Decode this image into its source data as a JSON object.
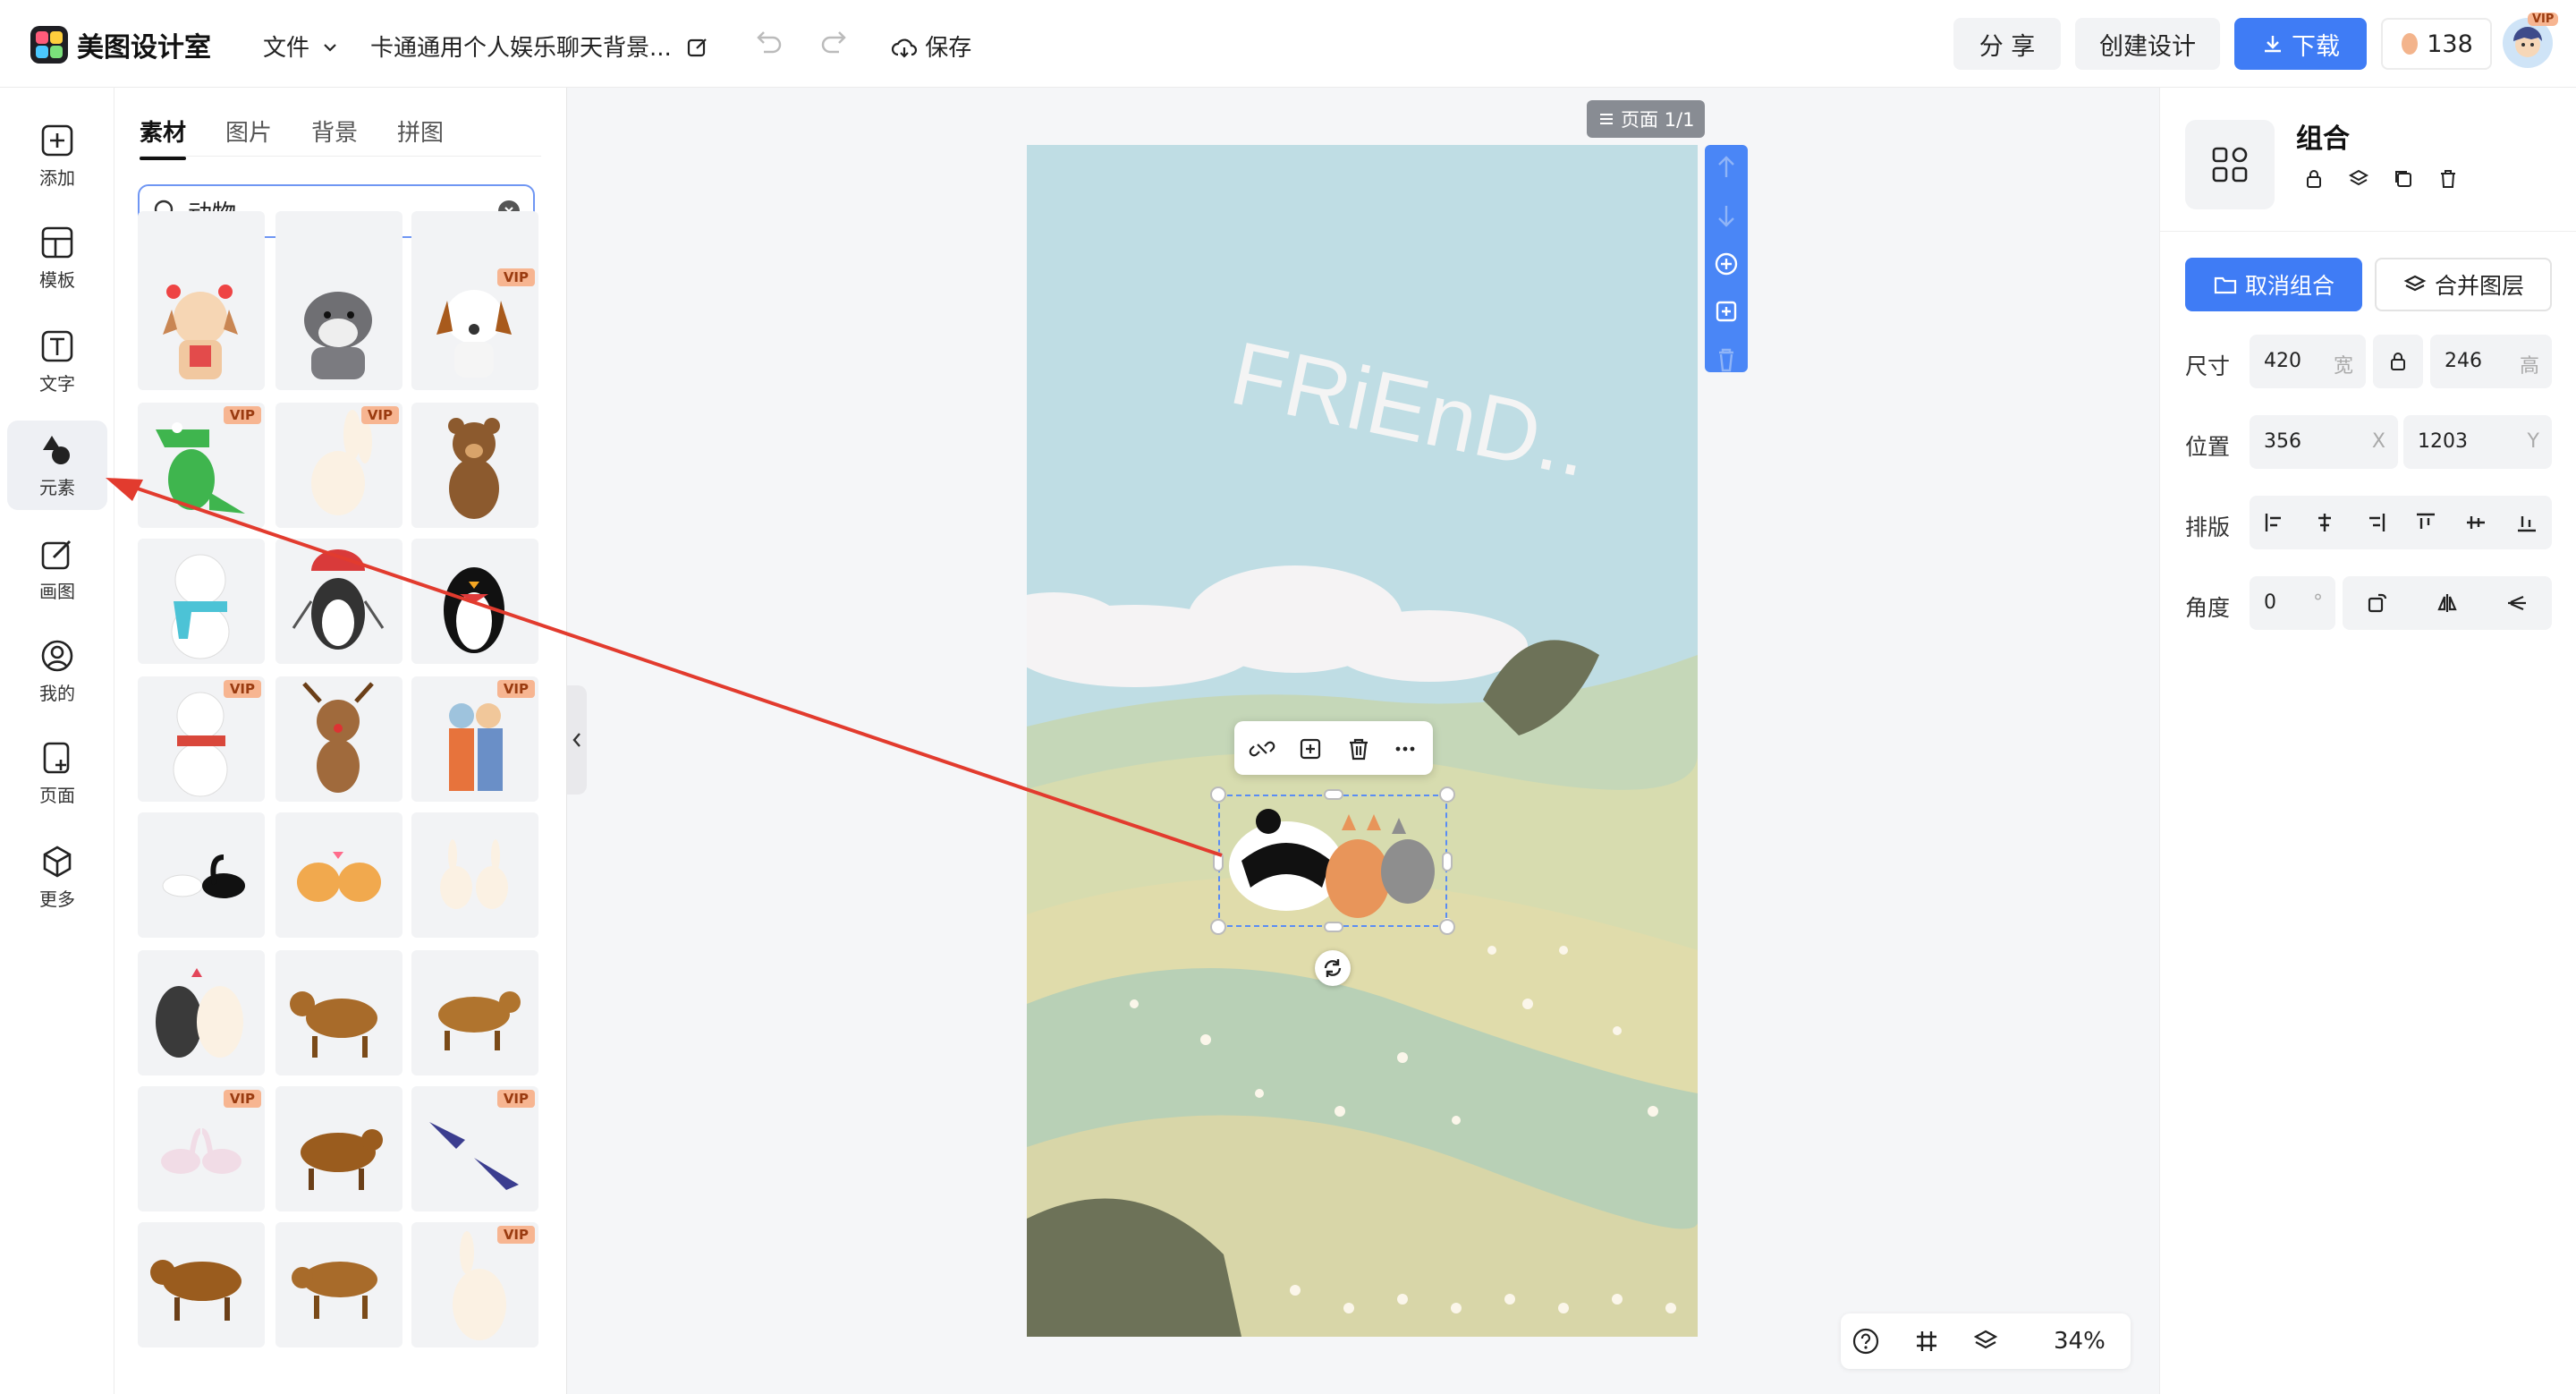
{
  "brand": {
    "name": "美图设计室"
  },
  "topbar": {
    "file_menu": "文件",
    "doc_title": "卡通通用个人娱乐聊天背景...",
    "save_label": "保存",
    "share_label": "分 享",
    "create_label": "创建设计",
    "download_label": "下载",
    "credits": "138",
    "vip_badge": "VIP"
  },
  "rail": {
    "items": [
      {
        "label": "添加",
        "icon": "plus-square-icon"
      },
      {
        "label": "模板",
        "icon": "template-icon"
      },
      {
        "label": "文字",
        "icon": "text-icon"
      },
      {
        "label": "元素",
        "icon": "shapes-icon"
      },
      {
        "label": "画图",
        "icon": "draw-icon"
      },
      {
        "label": "我的",
        "icon": "user-icon"
      },
      {
        "label": "页面",
        "icon": "page-add-icon"
      },
      {
        "label": "更多",
        "icon": "cube-icon"
      }
    ]
  },
  "panel": {
    "tabs": [
      "素材",
      "图片",
      "背景",
      "拼图"
    ],
    "search_value": "动物",
    "vip_label": "VIP"
  },
  "canvas": {
    "page_badge": "页面 1/1",
    "art_text": "FRiEnD..",
    "zoom": "34%"
  },
  "props": {
    "title": "组合",
    "ungroup_label": "取消组合",
    "merge_label": "合并图层",
    "size_label": "尺寸",
    "width": "420",
    "width_unit": "宽",
    "height": "246",
    "height_unit": "高",
    "position_label": "位置",
    "x": "356",
    "x_unit": "X",
    "y": "1203",
    "y_unit": "Y",
    "align_label": "排版",
    "angle_label": "角度",
    "angle": "0",
    "angle_unit": "°"
  },
  "colors": {
    "accent": "#3f7cf5",
    "annotation": "#e23b2e"
  }
}
